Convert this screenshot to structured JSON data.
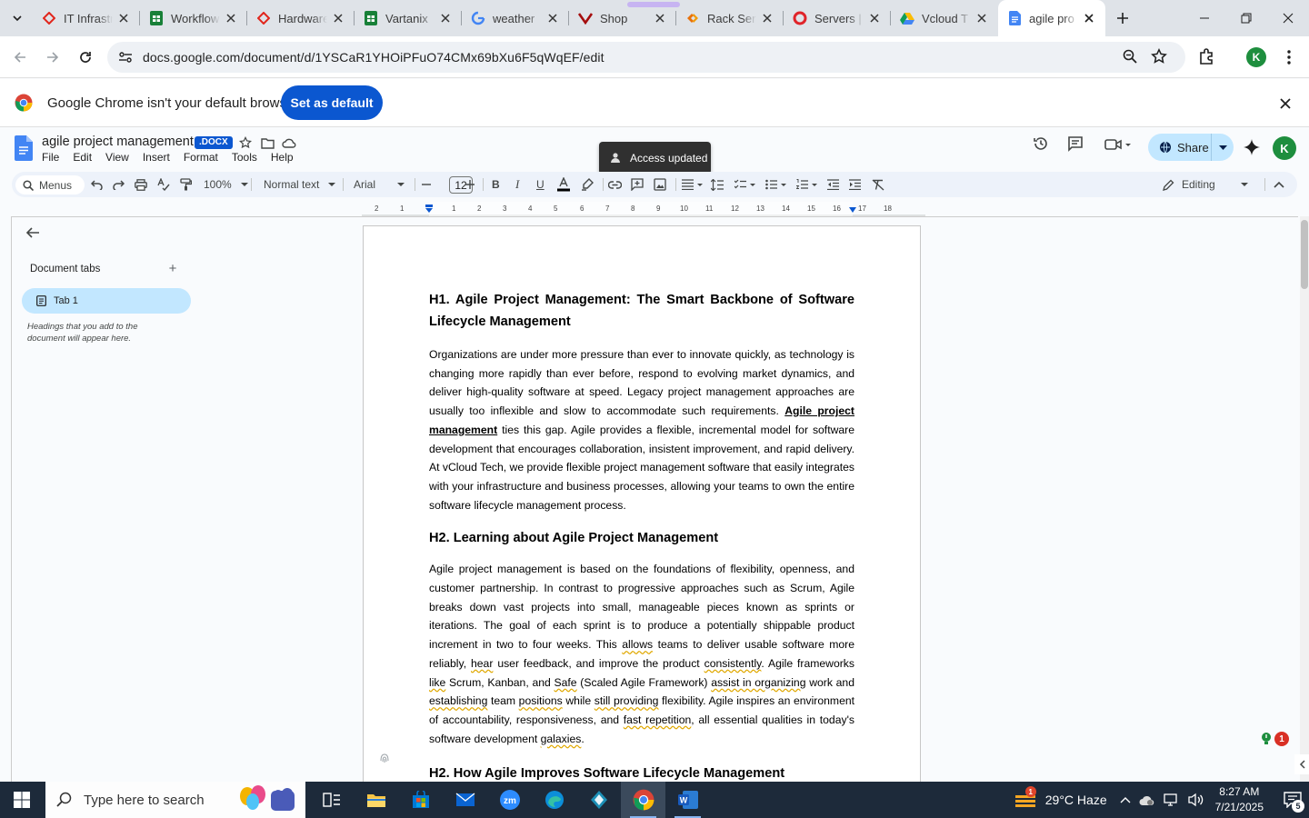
{
  "browser": {
    "tabs": [
      {
        "title": "IT Infrastructure",
        "icon": "red-diamond-icon"
      },
      {
        "title": "Workflow",
        "icon": "sheets-icon"
      },
      {
        "title": "Hardware",
        "icon": "red-diamond-icon"
      },
      {
        "title": "Vartanix",
        "icon": "sheets-icon"
      },
      {
        "title": "weather",
        "icon": "google-icon"
      },
      {
        "title": "Shop",
        "icon": "v-logo-icon"
      },
      {
        "title": "Rack Servers",
        "icon": "orange-logo-icon"
      },
      {
        "title": "Servers |",
        "icon": "opera-icon"
      },
      {
        "title": "Vcloud T",
        "icon": "drive-icon"
      },
      {
        "title": "agile pro",
        "icon": "docs-icon",
        "active": true
      }
    ],
    "url": "docs.google.com/document/d/1YSCaR1YHOiPFuO74CMx69bXu6F5qWqEF/edit",
    "profile_initial": "K"
  },
  "infobar": {
    "message": "Google Chrome isn't your default browser",
    "button": "Set as default"
  },
  "docs": {
    "title": "agile project management",
    "badge": ".DOCX",
    "menu": [
      "File",
      "Edit",
      "View",
      "Insert",
      "Format",
      "Tools",
      "Help"
    ],
    "toast": "Access updated",
    "share": "Share",
    "avatar": "K",
    "toolbar": {
      "menus": "Menus",
      "zoom": "100%",
      "style": "Normal text",
      "font": "Arial",
      "font_size": "12",
      "mode": "Editing"
    },
    "ruler_marks": [
      "2",
      "1",
      "1",
      "2",
      "3",
      "4",
      "5",
      "6",
      "7",
      "8",
      "9",
      "10",
      "11",
      "12",
      "13",
      "14",
      "15",
      "16",
      "17",
      "18"
    ],
    "sidebar": {
      "title": "Document tabs",
      "tab": "Tab 1",
      "hint": "Headings that you add to the document will appear here."
    },
    "content": {
      "h1": "H1. Agile Project Management: The Smart Backbone of Software Lifecycle Management",
      "p1_a": "Organizations are under more pressure than ever to innovate quickly, as technology is changing more rapidly than ever before, respond to evolving market dynamics, and deliver high-quality software at speed. Legacy project management approaches are usually too inflexible and slow to accommodate such requirements. ",
      "p1_link": "Agile project management",
      "p1_b": " ties this gap. Agile provides a flexible, incremental model for software development that encourages collaboration, insistent improvement, and rapid delivery. At vCloud Tech, we provide flexible project management software that easily integrates with your infrastructure and business processes, allowing your teams to own the entire software lifecycle management process.",
      "h2a": "H2. Learning about Agile Project Management",
      "p2_1": "Agile project management is based on the foundations of flexibility, openness, and customer partnership. In contrast to progressive approaches such as Scrum, Agile breaks down vast projects into small, manageable pieces known as sprints or iterations. The goal of each sprint is to produce a potentially shippable product increment in two to four weeks. This ",
      "p2_w1": "allows",
      "p2_2": " teams to deliver usable software more reliably, ",
      "p2_w2": "hear",
      "p2_3": " user feedback, and improve the product ",
      "p2_w3": "consistently",
      "p2_4": ". Agile frameworks ",
      "p2_w4": "like",
      "p2_5": " Scrum, Kanban, and ",
      "p2_w5": "Safe",
      "p2_6": " (Scaled Agile Framework) ",
      "p2_w6": "assist in organizing",
      "p2_7": " work and ",
      "p2_w7": "establishing",
      "p2_8": " team ",
      "p2_w8": "positions",
      "p2_9": " while ",
      "p2_w9": "still providing",
      "p2_10": " flexibility. Agile inspires an environment of accountability, responsiveness, and ",
      "p2_w10": "fast repetition",
      "p2_11": ", all essential qualities in today's software development ",
      "p2_w11": "galaxies",
      "p2_12": ".",
      "h2b": "H2. How Agile Improves Software Lifecycle Management"
    },
    "notification_count": "1"
  },
  "taskbar": {
    "search_placeholder": "Type here to search",
    "weather": "29°C  Haze",
    "weather_badge": "1",
    "time": "8:27 AM",
    "date": "7/21/2025",
    "notification_count": "5"
  },
  "colors": {
    "accent": "#0b57d0",
    "share_bg": "#c2e7ff",
    "taskbar": "#1d2a3a"
  }
}
